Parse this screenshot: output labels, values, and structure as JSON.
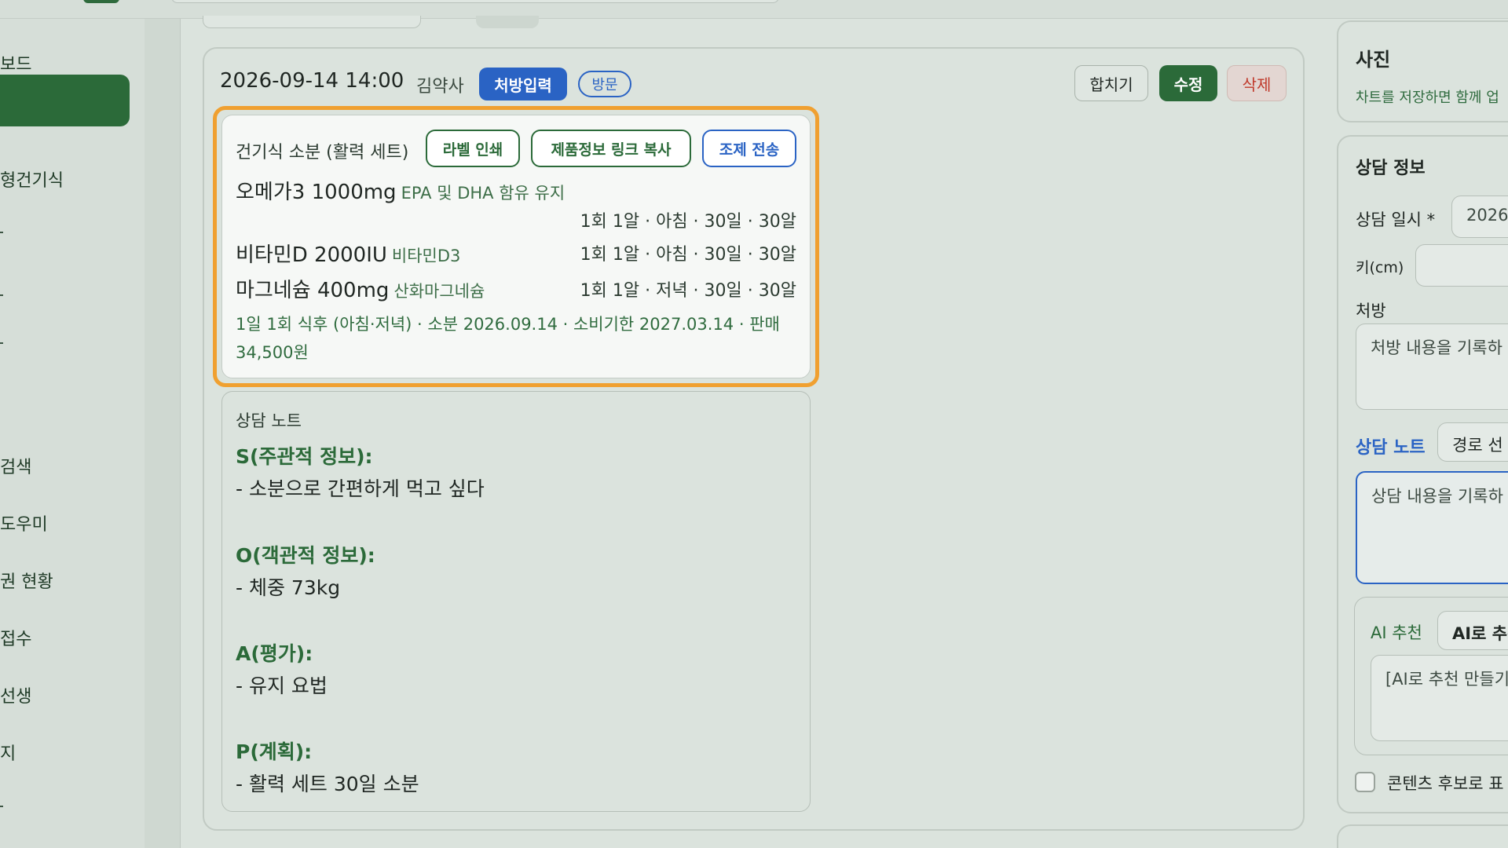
{
  "sidebar": {
    "items": [
      {
        "label": "보드",
        "active": false
      },
      {
        "label": "",
        "active": true
      },
      {
        "label": "형건기식",
        "active": false
      },
      {
        "label": "검색",
        "active": false
      },
      {
        "label": "도우미",
        "active": false
      },
      {
        "label": "권 현황",
        "active": false
      },
      {
        "label": "접수",
        "active": false
      },
      {
        "label": "선생",
        "active": false
      },
      {
        "label": "지",
        "active": false
      }
    ]
  },
  "record": {
    "datetime": "2026-09-14 14:00",
    "pharmacist": "김약사",
    "badge_rx": "처방입력",
    "badge_visit": "방문",
    "actions": {
      "merge": "합치기",
      "edit": "수정",
      "delete": "삭제"
    }
  },
  "prescription": {
    "title": "건기식 소분 (활력 세트)",
    "buttons": {
      "label_print": "라벨 인쇄",
      "copy_link": "제품정보 링크 복사",
      "send": "조제 전송"
    },
    "items": [
      {
        "name": "오메가3 1000mg",
        "sub": "EPA 및 DHA 함유 유지",
        "dose": "1회 1알 · 아침 · 30일 · 30알"
      },
      {
        "name": "비타민D 2000IU",
        "sub": "비타민D3",
        "dose": "1회 1알 · 아침 · 30일 · 30알"
      },
      {
        "name": "마그네슘 400mg",
        "sub": "산화마그네슘",
        "dose": "1회 1알 · 저녁 · 30일 · 30알"
      }
    ],
    "summary": "1일 1회 식후 (아침·저녁) · 소분 2026.09.14 · 소비기한 2027.03.14 · 판매 34,500원"
  },
  "consult_note": {
    "label": "상담 노트",
    "sections": [
      {
        "head": "S(주관적 정보):",
        "line": "- 소분으로 간편하게 먹고 싶다"
      },
      {
        "head": "O(객관적 정보):",
        "line": "- 체중 73kg"
      },
      {
        "head": "A(평가):",
        "line": "- 유지 요법"
      },
      {
        "head": "P(계획):",
        "line": "- 활력 세트 30일 소분"
      }
    ]
  },
  "right": {
    "photo": {
      "title": "사진",
      "hint": "차트를 저장하면 함께 업"
    },
    "consult_info": {
      "title": "상담 정보",
      "date_label": "상담 일시 *",
      "date_value": "2026",
      "height_label": "키(cm)",
      "height_value": "",
      "rx_label": "처방",
      "rx_placeholder": "처방 내용을 기록하",
      "note_tab": "상담 노트",
      "route_btn": "경로 선",
      "note_placeholder": "상담 내용을 기록하",
      "ai_label": "AI 추천",
      "ai_btn": "AI로 추천",
      "ai_placeholder": "[AI로 추천 만들기",
      "checkbox_label": "콘텐츠 후보로 표"
    }
  },
  "colors": {
    "brand_green": "#2b6a39",
    "accent_blue": "#2a63c4",
    "highlight_orange": "#f0a030",
    "danger_red": "#c0392b"
  }
}
